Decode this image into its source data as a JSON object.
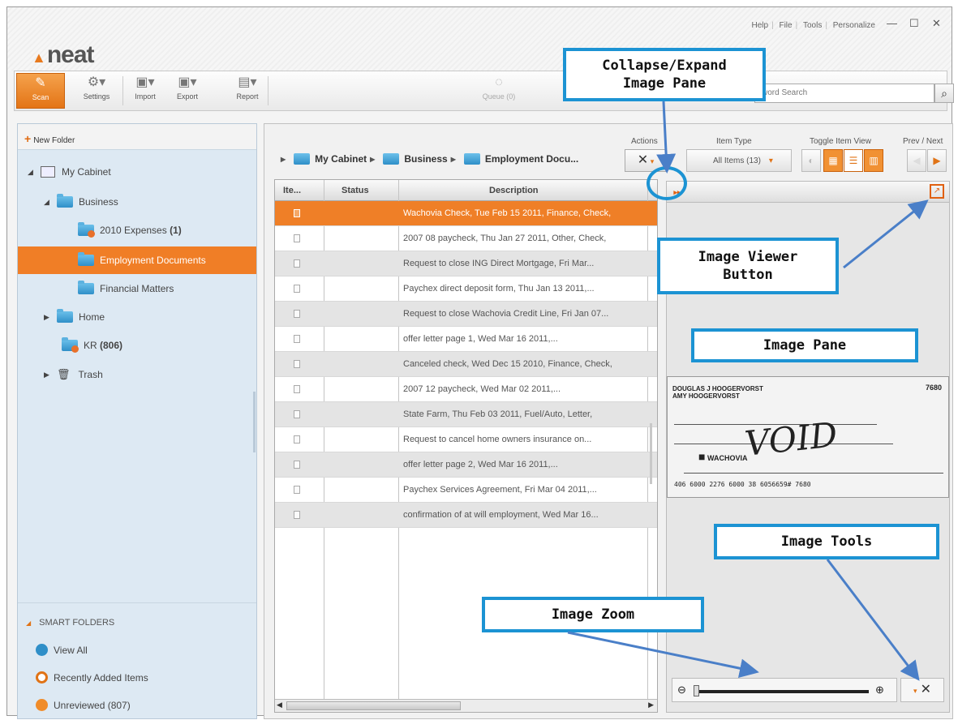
{
  "app": {
    "logo": "neat",
    "top_menu": [
      "Help",
      "File",
      "Tools",
      "Personalize"
    ],
    "window_controls": [
      "minimize",
      "maximize",
      "close"
    ]
  },
  "toolbar": {
    "buttons": [
      {
        "label": "Scan",
        "icon": "scanner-icon"
      },
      {
        "label": "Settings",
        "icon": "settings-icon"
      },
      {
        "label": "Import",
        "icon": "import-icon"
      },
      {
        "label": "Export",
        "icon": "export-icon"
      },
      {
        "label": "Report",
        "icon": "report-icon"
      }
    ],
    "queue_label": "Queue (0)",
    "search_placeholder": "word Search"
  },
  "sidebar": {
    "new_folder": "New Folder",
    "tree": [
      {
        "label": "My Cabinet",
        "level": 0
      },
      {
        "label": "Business",
        "level": 1
      },
      {
        "label": "2010 Expenses",
        "count": "(1)",
        "level": 2
      },
      {
        "label": "Employment Documents",
        "level": 2,
        "selected": true
      },
      {
        "label": "Financial Matters",
        "level": 2
      },
      {
        "label": "Home",
        "level": 1
      },
      {
        "label": "KR",
        "count": "(806)",
        "level": 1
      },
      {
        "label": "Trash",
        "level": 1
      }
    ],
    "smart_folders_header": "SMART FOLDERS",
    "smart_folders": [
      {
        "label": "View All",
        "color": "#2f8fc8"
      },
      {
        "label": "Recently Added Items",
        "color": "#e07316"
      },
      {
        "label": "Unreviewed (807)",
        "color": "#f08c2a"
      }
    ]
  },
  "main": {
    "breadcrumb": [
      "My Cabinet",
      "Business",
      "Employment Docu..."
    ],
    "actions_label": "Actions",
    "item_type_label": "Item Type",
    "item_type_value": "All Items (13)",
    "toggle_view_label": "Toggle Item View",
    "prev_next_label": "Prev / Next",
    "columns": [
      "Ite...",
      "Status",
      "Description"
    ],
    "rows": [
      "Wachovia Check, Tue Feb 15 2011, Finance, Check,",
      "2007 08 paycheck, Thu Jan 27 2011, Other, Check,",
      "Request to close ING Direct Mortgage, Fri Mar...",
      "Paychex direct deposit form, Thu Jan 13 2011,...",
      "Request to close Wachovia Credit Line, Fri Jan 07...",
      "offer letter page 1, Wed Mar 16 2011,...",
      "Canceled check, Wed Dec 15 2010, Finance, Check,",
      "2007 12 paycheck, Wed Mar 02 2011,...",
      "State Farm, Thu Feb 03 2011, Fuel/Auto, Letter,",
      "Request to cancel home owners insurance on...",
      "offer letter page 2, Wed Mar 16 2011,...",
      "Paychex Services Agreement, Fri Mar 04 2011,...",
      "confirmation of at will employment, Wed Mar 16..."
    ]
  },
  "check": {
    "names": "DOUGLAS J HOOGERVORST\nAMY HOOGERVORST",
    "number": "7680",
    "handwriting": "VOID",
    "bank": "WACHOVIA",
    "micr": "406 6000 2276 6000 38 6056659# 7680"
  },
  "callouts": {
    "collapse": "Collapse/Expand\nImage Pane",
    "viewer": "Image Viewer\nButton",
    "pane": "Image Pane",
    "tools": "Image Tools",
    "zoom": "Image Zoom"
  },
  "colors": {
    "accent": "#ef7f27",
    "callout_blue": "#1c93d3"
  }
}
